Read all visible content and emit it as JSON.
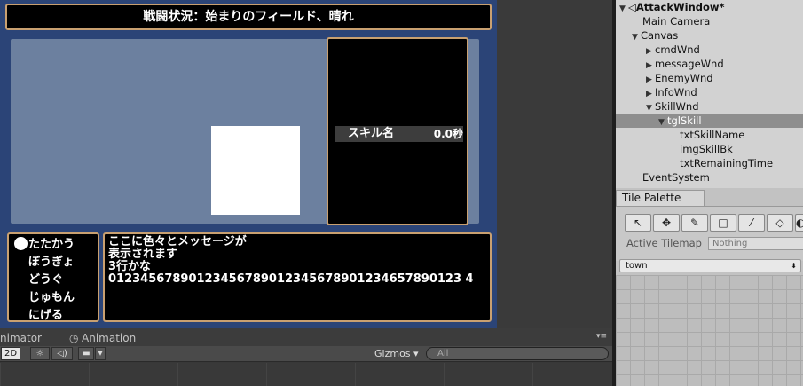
{
  "game": {
    "status_text": "戦闘状況：始まりのフィールド、晴れ",
    "skill": {
      "name": "スキル名",
      "remaining": "0.0秒"
    },
    "commands": [
      "たたかう",
      "ぼうぎょ",
      "どうぐ",
      "じゅもん",
      "にげる"
    ],
    "message_lines": [
      "ここに色々とメッセージが",
      "表示されます",
      "3行かな",
      "01234567890123456789012345678901234657890123 4"
    ]
  },
  "bottom_panel": {
    "tab_animator": "nimator",
    "tab_animation": "Animation",
    "btn_2d": "2D",
    "gizmos_label": "Gizmos",
    "search_placeholder": "All"
  },
  "hierarchy": {
    "scene_name": "AttackWindow*",
    "items": [
      {
        "label": "Main Camera"
      },
      {
        "label": "Canvas"
      },
      {
        "label": "cmdWnd"
      },
      {
        "label": "messageWnd"
      },
      {
        "label": "EnemyWnd"
      },
      {
        "label": "InfoWnd"
      },
      {
        "label": "SkillWnd"
      },
      {
        "label": "tglSkill"
      },
      {
        "label": "txtSkillName"
      },
      {
        "label": "imgSkillBk"
      },
      {
        "label": "txtRemainingTime"
      },
      {
        "label": "EventSystem"
      }
    ]
  },
  "tile_palette": {
    "tab_label": "Tile Palette",
    "active_tilemap_label": "Active Tilemap",
    "active_tilemap_value": "Nothing",
    "palette_select": "town"
  },
  "colors": {
    "game_bg": "#2b4477",
    "window_border": "#c9a070",
    "enemy_area": "#6c809f"
  }
}
